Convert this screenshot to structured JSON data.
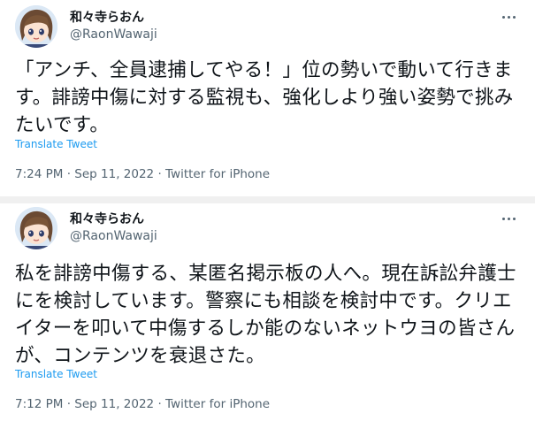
{
  "tweets": [
    {
      "display_name": "和々寺らおん",
      "handle": "@RaonWawaji",
      "text": "「アンチ、全員逮捕してやる！」位の勢いで動いて行きます。誹謗中傷に対する監視も、強化しより強い姿勢で挑みたいです。",
      "translate_label": "Translate Tweet",
      "time": "7:24 PM",
      "date": "Sep 11, 2022",
      "source": "Twitter for iPhone",
      "separator": "·"
    },
    {
      "display_name": "和々寺らおん",
      "handle": "@RaonWawaji",
      "text": "私を誹謗中傷する、某匿名掲示板の人へ。現在訴訟弁護士にを検討しています。警察にも相談を検討中です。クリエイターを叩いて中傷するしか能のないネットウヨの皆さんが、コンテンツを衰退さた。",
      "translate_label": "Translate Tweet",
      "time": "7:12 PM",
      "date": "Sep 11, 2022",
      "source": "Twitter for iPhone",
      "separator": "·"
    }
  ],
  "icons": {
    "avatar": "anime-girl-avatar",
    "more": "more-options-icon"
  },
  "colors": {
    "text": "#0f1419",
    "secondary": "#536471",
    "link": "#1d9bf0",
    "separator_band": "#f0f0f0"
  }
}
